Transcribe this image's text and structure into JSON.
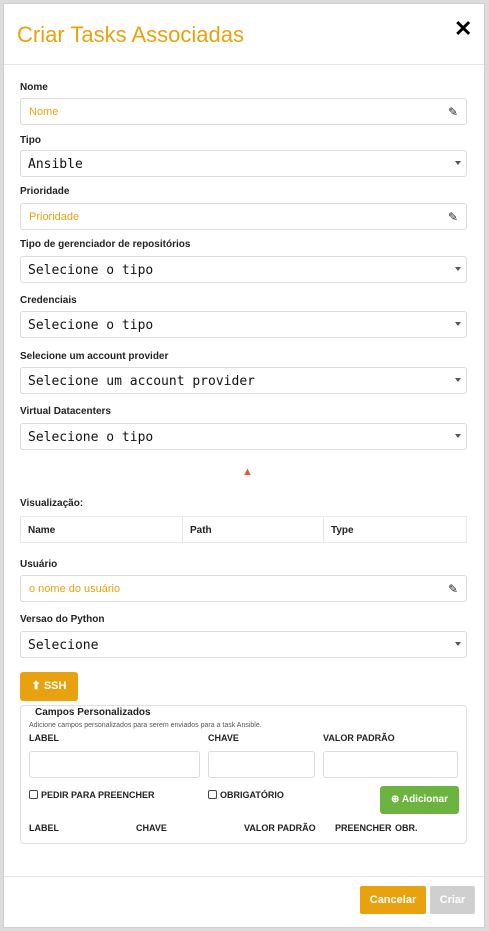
{
  "modal": {
    "title": "Criar Tasks Associadas",
    "close_icon": "close-icon"
  },
  "fields": {
    "nome": {
      "label": "Nome",
      "placeholder": "Nome"
    },
    "tipo": {
      "label": "Tipo",
      "value": "Ansible"
    },
    "prioridade": {
      "label": "Prioridade",
      "placeholder": "Prioridade"
    },
    "repo_manager": {
      "label": "Tipo de gerenciador de repositórios",
      "value": "Selecione o tipo"
    },
    "credenciais": {
      "label": "Credenciais",
      "value": "Selecione o tipo"
    },
    "account_provider": {
      "label": "Selecione um account provider",
      "value": "Selecione um account provider"
    },
    "virtual_datacenters": {
      "label": "Virtual Datacenters",
      "value": "Selecione o tipo"
    },
    "usuario": {
      "label": "Usuário",
      "placeholder": "o nome do usuário"
    },
    "python": {
      "label": "Versao do Python",
      "value": "Selecione"
    }
  },
  "visualizacao": {
    "label": "Visualização:",
    "columns": [
      "Name",
      "Path",
      "Type"
    ]
  },
  "ssh_button": "SSH",
  "custom_fields": {
    "legend": "Campos Personalizados",
    "hint": "Adicione campos personalizados para serem enviados para a task Ansible.",
    "label_col": "LABEL",
    "key_col": "CHAVE",
    "default_col": "VALOR PADRÃO",
    "ask_fill": "PEDIR PARA PREENCHER",
    "required": "OBRIGATÓRIO",
    "add_button": "Adicionar",
    "table_headers": [
      "LABEL",
      "CHAVE",
      "VALOR PADRÃO",
      "PREENCHER",
      "OBR."
    ]
  },
  "footer": {
    "cancel": "Cancelar",
    "create": "Criar"
  },
  "colors": {
    "accent": "#e8a20f",
    "success": "#6db33f",
    "warning": "#e3582a",
    "disabled": "#cfcfcf"
  }
}
